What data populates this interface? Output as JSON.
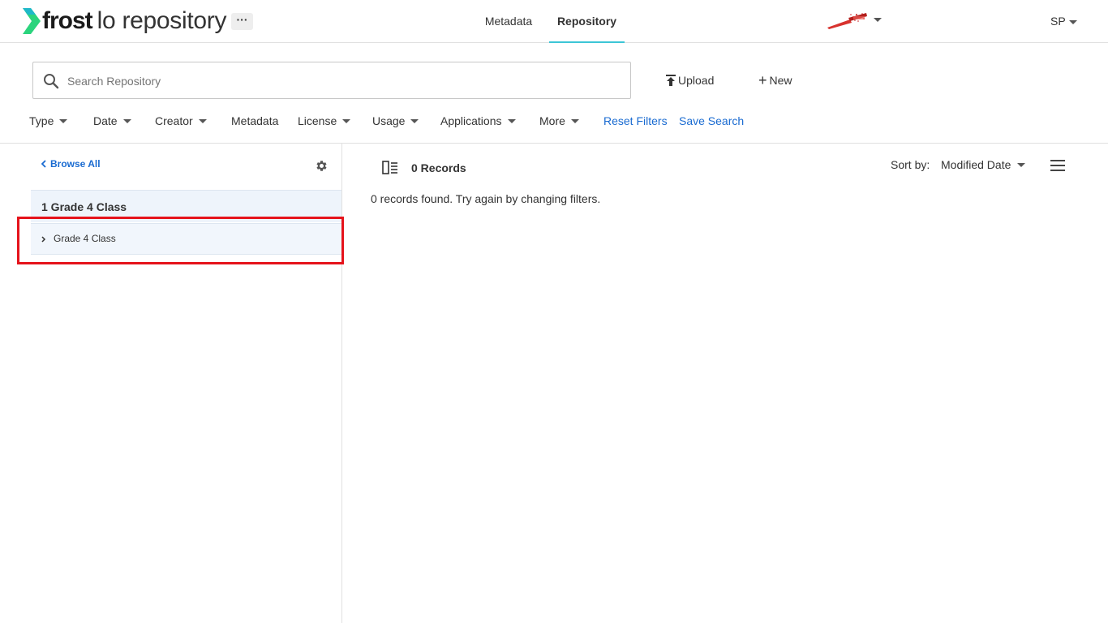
{
  "header": {
    "logo_bold": "frost",
    "logo_light": "lo repository",
    "more_label": "···",
    "tabs": [
      {
        "label": "Metadata",
        "active": false
      },
      {
        "label": "Repository",
        "active": true
      }
    ],
    "user_initials": "SP"
  },
  "search": {
    "placeholder": "Search Repository",
    "value": ""
  },
  "actions": {
    "upload_label": "Upload",
    "new_label": "New"
  },
  "filters": [
    {
      "label": "Type",
      "dropdown": true
    },
    {
      "label": "Date",
      "dropdown": true
    },
    {
      "label": "Creator",
      "dropdown": true
    },
    {
      "label": "Metadata",
      "dropdown": false
    },
    {
      "label": "License",
      "dropdown": true
    },
    {
      "label": "Usage",
      "dropdown": true
    },
    {
      "label": "Applications",
      "dropdown": true
    },
    {
      "label": "More",
      "dropdown": true
    }
  ],
  "filter_links": {
    "reset": "Reset Filters",
    "save": "Save Search"
  },
  "sidebar": {
    "browse_all": "Browse All",
    "tree_header": "1 Grade 4 Class",
    "tree_items": [
      {
        "label": "Grade 4 Class"
      }
    ]
  },
  "results": {
    "count_label": "0 Records",
    "empty_message": "0 records found. Try again by changing filters.",
    "sort_label": "Sort by:",
    "sort_value": "Modified Date"
  },
  "colors": {
    "accent": "#3cc6d6",
    "link": "#1a6bd1",
    "logo_green": "#2bd47d",
    "highlight": "#e5131b"
  },
  "icons": {
    "search": "search-icon",
    "upload": "upload-icon",
    "new": "plus-icon",
    "settings": "gear-icon",
    "panel_toggle": "panel-toggle-icon",
    "list_view": "list-view-icon"
  }
}
